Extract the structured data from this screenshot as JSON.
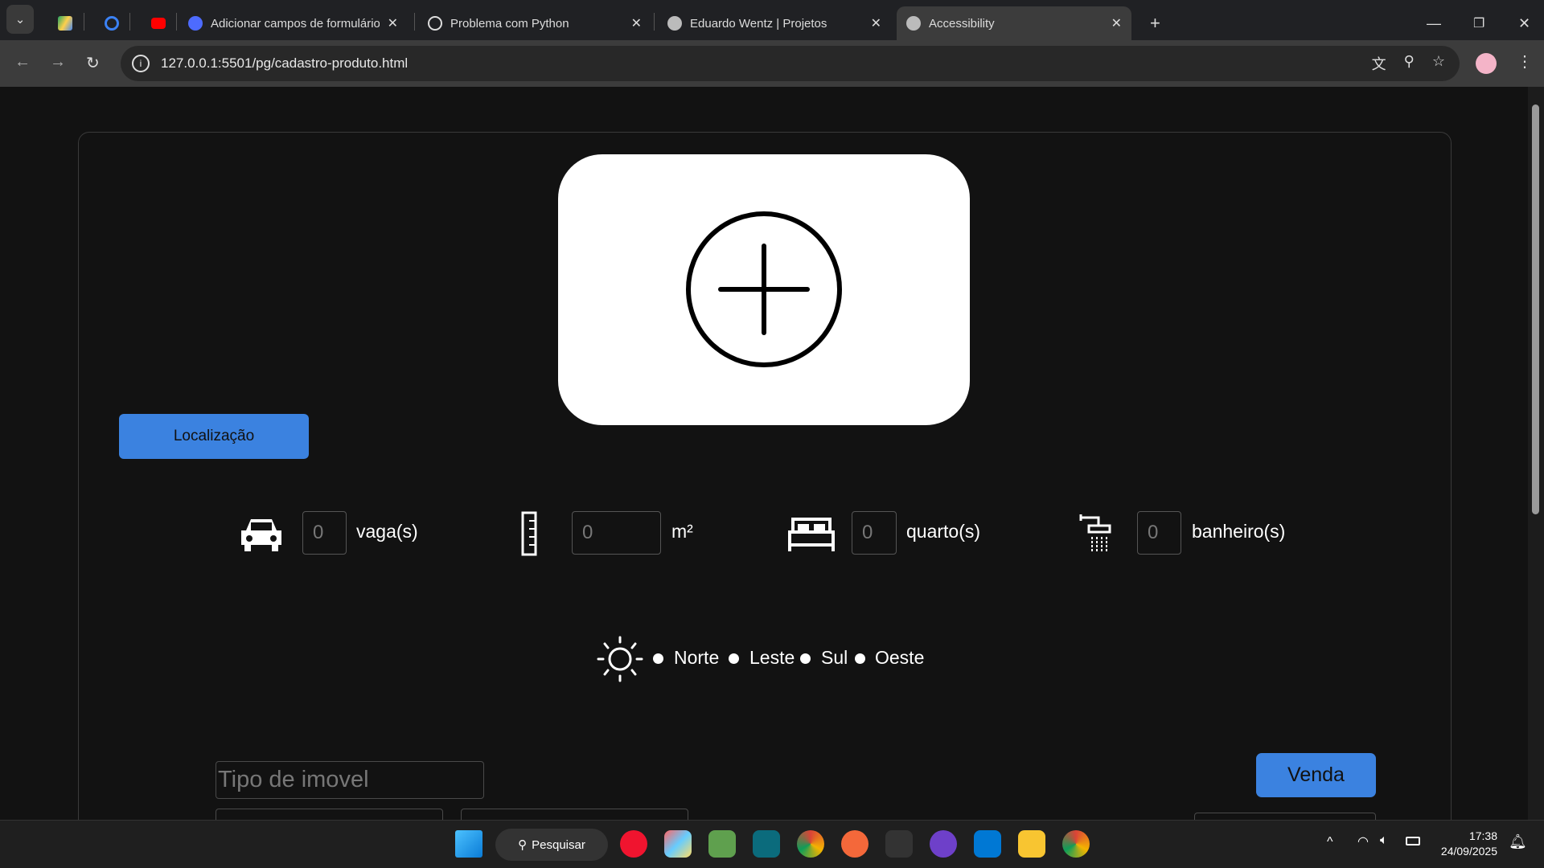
{
  "browser": {
    "tabs": [
      {
        "label": "",
        "icon": "google-drive-icon"
      },
      {
        "label": "",
        "icon": "check-icon"
      },
      {
        "label": "",
        "icon": "youtube-icon"
      },
      {
        "label": "Adicionar campos de formulário",
        "icon": "deepseek-icon"
      },
      {
        "label": "Problema com Python",
        "icon": "chatgpt-icon"
      },
      {
        "label": "Eduardo Wentz | Projetos",
        "icon": "globe-icon"
      },
      {
        "label": "Accessibility",
        "icon": "globe-icon",
        "active": true
      }
    ],
    "url": "127.0.0.1:5501/pg/cadastro-produto.html"
  },
  "form": {
    "location_button": "Localização",
    "fields": [
      {
        "value": "0",
        "unit": "vaga(s)",
        "icon": "car-icon"
      },
      {
        "value": "0",
        "unit": "m²",
        "icon": "ruler-icon"
      },
      {
        "value": "0",
        "unit": "quarto(s)",
        "icon": "bed-icon"
      },
      {
        "value": "0",
        "unit": "banheiro(s)",
        "icon": "shower-icon"
      }
    ],
    "orientation": [
      "Norte",
      "Leste",
      "Sul",
      "Oeste"
    ],
    "tipo_placeholder": "Tipo de imovel",
    "venda_button": "Venda"
  },
  "taskbar": {
    "search": "Pesquisar",
    "time": "17:38",
    "date": "24/09/2025"
  },
  "colors": {
    "accent": "#3b82e0",
    "background": "#121212"
  }
}
